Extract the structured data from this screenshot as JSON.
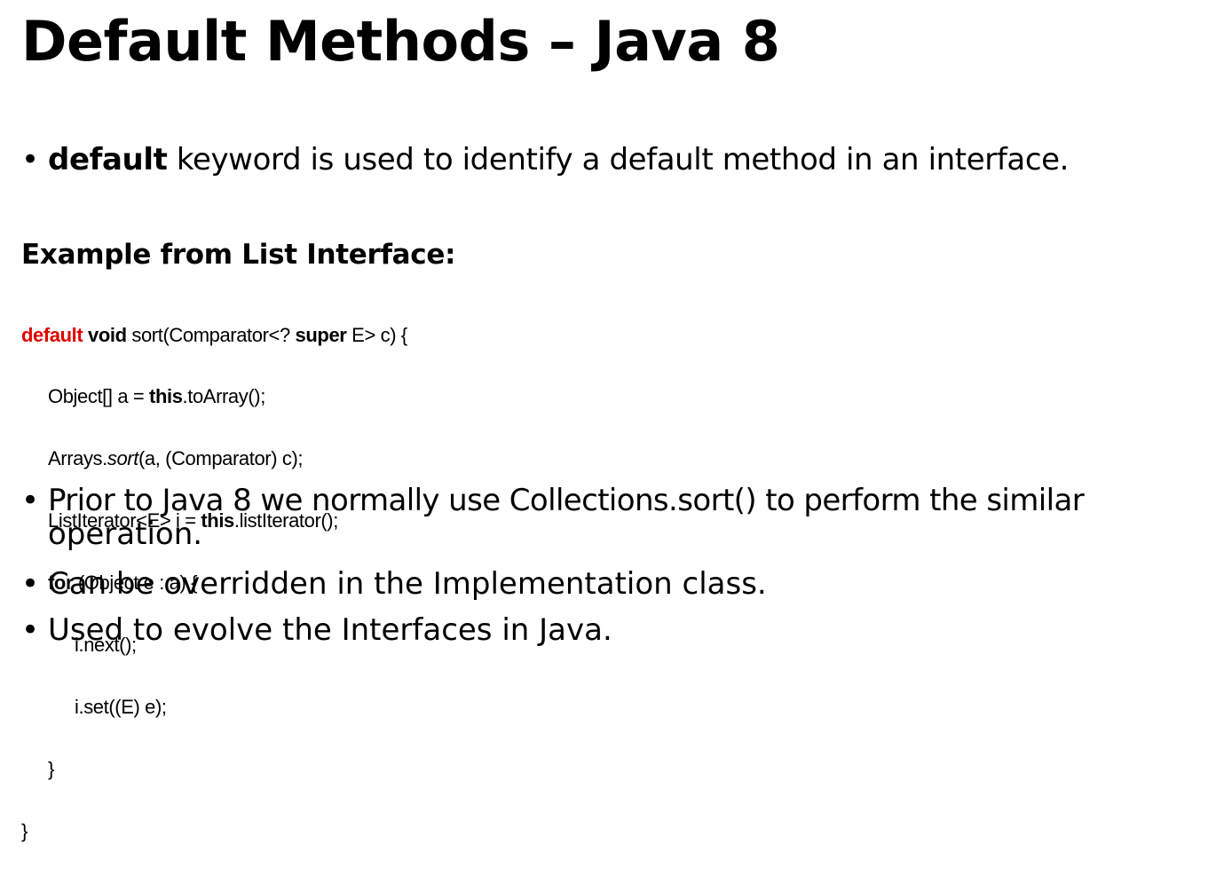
{
  "slide": {
    "title": "Default Methods – Java 8",
    "bullet_1": {
      "keyword": "default",
      "text": " keyword is used to identify a default method in an interface."
    },
    "subheading": "Example from List Interface:",
    "code": {
      "line1": {
        "kw_default": "default",
        "sp1": " ",
        "kw_void": "void",
        "mid": " sort(Comparator<? ",
        "kw_super": "super",
        "end": " E> c) {"
      },
      "line2": {
        "start": "Object[] a = ",
        "kw_this": "this",
        "end": ".toArray();"
      },
      "line3": {
        "start": "Arrays.",
        "italic": "sort",
        "end": "(a, (Comparator) c);"
      },
      "line4": {
        "start": "ListIterator<E> i = ",
        "kw_this": "this",
        "end": ".listIterator();"
      },
      "line5": {
        "kw_for": "for",
        "end": " (Object e : a) {"
      },
      "line6": "i.next();",
      "line7": "i.set((E) e);",
      "line8": "}",
      "line9": "}"
    },
    "bullet_2": {
      "line1": "Prior to Java 8 we normally use Collections.sort() to perform the similar",
      "line2": "operation."
    },
    "bullet_3": "Can be overridden in the Implementation class.",
    "bullet_4": "Used to evolve the Interfaces in Java.",
    "bullet_glyph": "•"
  }
}
